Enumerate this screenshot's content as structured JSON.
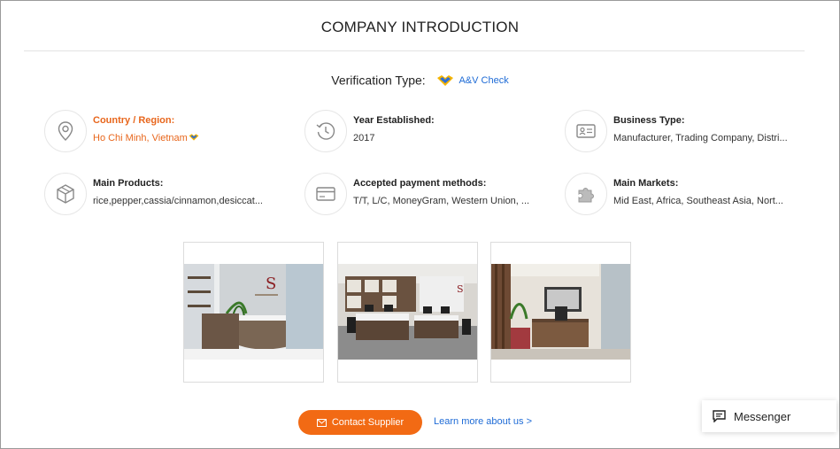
{
  "section": {
    "title": "COMPANY INTRODUCTION"
  },
  "verification": {
    "label": "Verification Type:",
    "badge": "A&V Check"
  },
  "info": {
    "country": {
      "label": "Country / Region:",
      "value": "Ho Chi Minh, Vietnam",
      "icon": "location-pin-icon"
    },
    "established": {
      "label": "Year Established:",
      "value": "2017",
      "icon": "history-clock-icon"
    },
    "business_type": {
      "label": "Business Type:",
      "value": "Manufacturer, Trading Company, Distri...",
      "icon": "id-card-icon"
    },
    "main_products": {
      "label": "Main Products:",
      "value": "rice,pepper,cassia/cinnamon,desiccat...",
      "icon": "box-icon"
    },
    "payment": {
      "label": "Accepted payment methods:",
      "value": "T/T, L/C, MoneyGram, Western Union, ...",
      "icon": "credit-card-icon"
    },
    "markets": {
      "label": "Main Markets:",
      "value": "Mid East, Africa, Southeast Asia, Nort...",
      "icon": "puzzle-icon"
    }
  },
  "photos": [
    "office-reception-photo",
    "open-office-desks-photo",
    "executive-office-photo"
  ],
  "actions": {
    "contact": "Contact Supplier",
    "learn_more": "Learn more about us >"
  },
  "messenger": {
    "label": "Messenger"
  },
  "colors": {
    "accent": "#f26a14",
    "link": "#1e6bd6",
    "highlight": "#e8661c"
  }
}
